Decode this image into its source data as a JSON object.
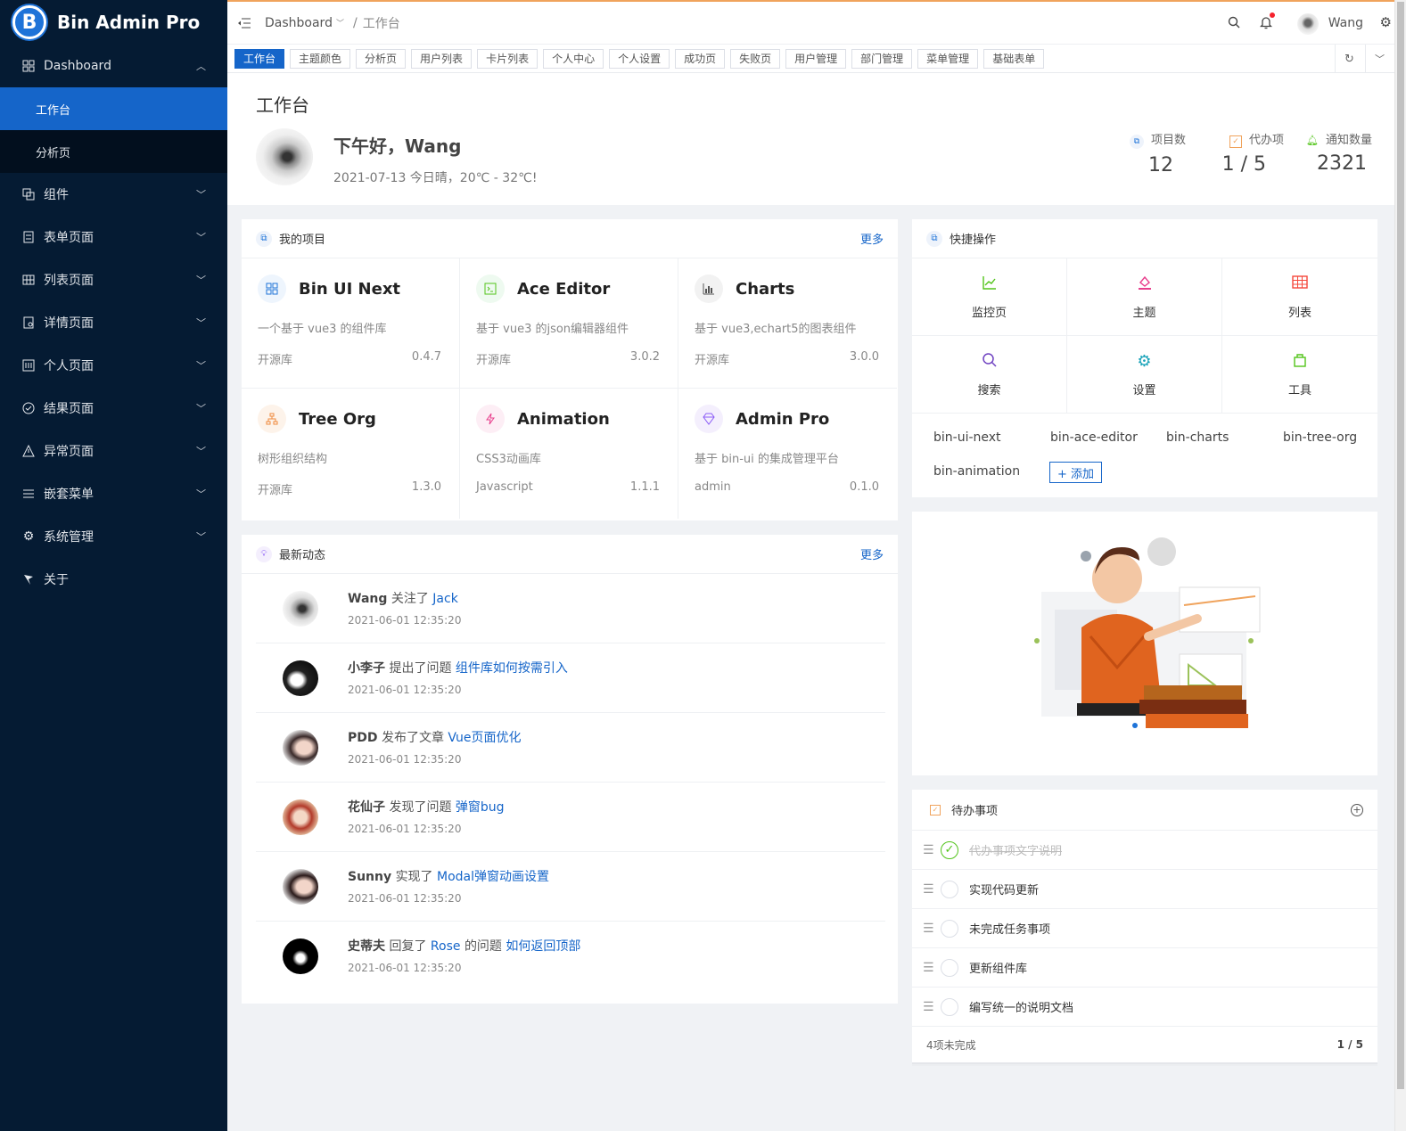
{
  "brand": {
    "logo_letter": "B",
    "name": "Bin Admin Pro"
  },
  "sidebar": {
    "items": [
      {
        "label": "Dashboard",
        "icon": "grid-icon",
        "expanded": true
      },
      {
        "label": "组件",
        "icon": "copy-icon"
      },
      {
        "label": "表单页面",
        "icon": "form-icon"
      },
      {
        "label": "列表页面",
        "icon": "table-icon"
      },
      {
        "label": "详情页面",
        "icon": "detail-icon"
      },
      {
        "label": "个人页面",
        "icon": "profile-icon"
      },
      {
        "label": "结果页面",
        "icon": "check-circle-icon"
      },
      {
        "label": "异常页面",
        "icon": "warning-icon"
      },
      {
        "label": "嵌套菜单",
        "icon": "menu-icon"
      },
      {
        "label": "系统管理",
        "icon": "gear-icon"
      },
      {
        "label": "关于",
        "icon": "flag-icon"
      }
    ],
    "dashboard_children": [
      {
        "label": "工作台",
        "active": true
      },
      {
        "label": "分析页"
      }
    ]
  },
  "topbar": {
    "breadcrumb_root": "Dashboard",
    "breadcrumb_sep": "/",
    "breadcrumb_current": "工作台",
    "username": "Wang"
  },
  "tabs": [
    "工作台",
    "主题颜色",
    "分析页",
    "用户列表",
    "卡片列表",
    "个人中心",
    "个人设置",
    "成功页",
    "失败页",
    "用户管理",
    "部门管理",
    "菜单管理",
    "基础表单"
  ],
  "header": {
    "page_title": "工作台",
    "greeting": "下午好，Wang",
    "weather": "2021-07-13 今日晴，20℃ - 32℃!",
    "stats": [
      {
        "label": "项目数",
        "value": "12",
        "color": "#1e73d8"
      },
      {
        "label": "代办项",
        "value": "1 / 5",
        "color": "#f0a35c"
      },
      {
        "label": "通知数量",
        "value": "2321",
        "color": "#52c41a"
      }
    ]
  },
  "projects": {
    "title": "我的项目",
    "more": "更多",
    "items": [
      {
        "name": "Bin UI Next",
        "desc": "一个基于 vue3 的组件库",
        "type": "开源库",
        "version": "0.4.7",
        "icon": "grid-icon",
        "color": "#1e73d8",
        "bg": "#eef5fd"
      },
      {
        "name": "Ace Editor",
        "desc": "基于 vue3 的json编辑器组件",
        "type": "开源库",
        "version": "3.0.2",
        "icon": "terminal-icon",
        "color": "#52c41a",
        "bg": "#eefaf0"
      },
      {
        "name": "Charts",
        "desc": "基于 vue3,echart5的图表组件",
        "type": "开源库",
        "version": "3.0.0",
        "icon": "bar-chart-icon",
        "color": "#555555",
        "bg": "#f2f2f2"
      },
      {
        "name": "Tree Org",
        "desc": "树形组织结构",
        "type": "开源库",
        "version": "1.3.0",
        "icon": "org-icon",
        "color": "#f08a3c",
        "bg": "#fdf3ea"
      },
      {
        "name": "Animation",
        "desc": "CSS3动画库",
        "type": "Javascript",
        "version": "1.1.1",
        "icon": "lightning-icon",
        "color": "#e83e8c",
        "bg": "#fdeef5"
      },
      {
        "name": "Admin Pro",
        "desc": "基于 bin-ui 的集成管理平台",
        "type": "admin",
        "version": "0.1.0",
        "icon": "diamond-icon",
        "color": "#8b5cf6",
        "bg": "#f4effd"
      }
    ]
  },
  "quick": {
    "title": "快捷操作",
    "items": [
      {
        "label": "监控页",
        "icon": "line-chart-icon",
        "color": "#52c41a"
      },
      {
        "label": "主题",
        "icon": "paint-icon",
        "color": "#e83e8c"
      },
      {
        "label": "列表",
        "icon": "table-icon",
        "color": "#f5483b"
      },
      {
        "label": "搜索",
        "icon": "search-icon",
        "color": "#6f42c1"
      },
      {
        "label": "设置",
        "icon": "gear-icon",
        "color": "#17a2b8"
      },
      {
        "label": "工具",
        "icon": "bag-icon",
        "color": "#52c41a"
      }
    ],
    "links": [
      "bin-ui-next",
      "bin-ace-editor",
      "bin-charts",
      "bin-tree-org",
      "bin-animation"
    ],
    "add_label": "+ 添加"
  },
  "feed": {
    "title": "最新动态",
    "more": "更多",
    "items": [
      {
        "user": "Wang",
        "action": "关注了",
        "target": "Jack",
        "extra": "",
        "target2": "",
        "time": "2021-06-01 12:35:20"
      },
      {
        "user": "小李子",
        "action": "提出了问题",
        "target": "组件库如何按需引入",
        "extra": "",
        "target2": "",
        "time": "2021-06-01 12:35:20"
      },
      {
        "user": "PDD",
        "action": "发布了文章",
        "target": "Vue页面优化",
        "extra": "",
        "target2": "",
        "time": "2021-06-01 12:35:20"
      },
      {
        "user": "花仙子",
        "action": "发现了问题",
        "target": "弹窗bug",
        "extra": "",
        "target2": "",
        "time": "2021-06-01 12:35:20"
      },
      {
        "user": "Sunny",
        "action": "实现了",
        "target": "Modal弹窗动画设置",
        "extra": "",
        "target2": "",
        "time": "2021-06-01 12:35:20"
      },
      {
        "user": "史蒂夫",
        "action": "回复了",
        "target": "Rose",
        "extra": "的问题",
        "target2": "如何返回顶部",
        "time": "2021-06-01 12:35:20"
      }
    ]
  },
  "todo": {
    "title": "待办事项",
    "items": [
      {
        "text": "代办事项文字说明",
        "done": true
      },
      {
        "text": "实现代码更新",
        "done": false
      },
      {
        "text": "未完成任务事项",
        "done": false
      },
      {
        "text": "更新组件库",
        "done": false
      },
      {
        "text": "编写统一的说明文档",
        "done": false
      }
    ],
    "footer_left": "4项未完成",
    "footer_right": "1 / 5"
  }
}
